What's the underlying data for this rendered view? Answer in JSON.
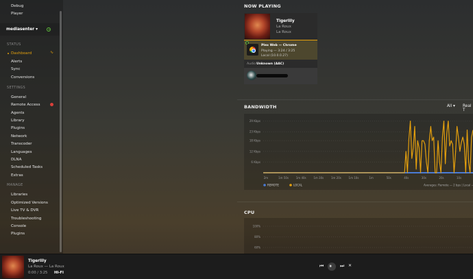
{
  "sidebar": {
    "top_items": [
      {
        "label": "Debug"
      },
      {
        "label": "Player"
      }
    ],
    "server": {
      "name": "mediasenter",
      "caret": "▾"
    },
    "status_heading": "STATUS",
    "status_items": [
      {
        "label": "Dashboard"
      },
      {
        "label": "Alerts"
      },
      {
        "label": "Sync"
      },
      {
        "label": "Conversions"
      }
    ],
    "settings_heading": "SETTINGS",
    "settings_items": [
      {
        "label": "General"
      },
      {
        "label": "Remote Access"
      },
      {
        "label": "Agents"
      },
      {
        "label": "Library"
      },
      {
        "label": "Plugins"
      },
      {
        "label": "Network"
      },
      {
        "label": "Transcoder"
      },
      {
        "label": "Languages"
      },
      {
        "label": "DLNA"
      },
      {
        "label": "Scheduled Tasks"
      },
      {
        "label": "Extras"
      }
    ],
    "manage_heading": "MANAGE",
    "manage_items": [
      {
        "label": "Libraries"
      },
      {
        "label": "Optimized Versions"
      },
      {
        "label": "Live TV & DVR"
      },
      {
        "label": "Troubleshooting"
      },
      {
        "label": "Console"
      },
      {
        "label": "Plugins"
      }
    ]
  },
  "now_playing": {
    "heading": "NOW PLAYING",
    "title": "Tigerlily",
    "artist": "La Roux",
    "album": "La Roux",
    "player_line1": "Plex Web  —  Chrome",
    "player_line2": "Playing — 3:24 / 3:25",
    "player_line3": "Local (10.0.0.27)",
    "audio_label": "Audio",
    "audio_value": "Unknown (AAC)"
  },
  "bandwidth": {
    "heading": "BANDWIDTH",
    "filter_all": "All ▾",
    "filter_real": "Real T"
  },
  "chart_data": {
    "type": "line",
    "title": "",
    "ylabel": "",
    "xlabel": "",
    "y_ticks": [
      "29 Kbps",
      "23 Kbps",
      "18 Kbps",
      "12 Kbps",
      "6 Kbps"
    ],
    "y_tick_values": [
      29,
      23,
      18,
      12,
      6
    ],
    "x_ticks": [
      "2m",
      "1m 50s",
      "1m 40s",
      "1m 30s",
      "1m 20s",
      "1m 10s",
      "1m",
      "50s",
      "40s",
      "30s",
      "20s",
      "10s"
    ],
    "ylim": [
      0,
      30
    ],
    "series": [
      {
        "name": "REMOTE",
        "color": "#4a7bd6",
        "values": [
          0,
          0,
          0,
          0,
          0,
          0,
          0,
          0,
          0,
          0,
          0,
          0,
          0,
          0,
          0,
          0,
          0,
          0,
          0,
          0,
          0,
          0,
          0,
          0,
          0,
          0,
          0,
          0,
          0,
          0,
          0,
          0,
          0,
          0,
          0,
          0,
          0,
          0,
          0,
          0,
          0,
          0,
          0,
          0,
          0,
          0,
          0,
          0,
          0,
          0,
          0,
          0,
          0,
          0,
          0,
          0,
          0,
          0,
          0,
          0,
          0,
          0,
          0,
          0,
          0,
          0,
          0,
          0,
          0,
          0,
          0,
          0,
          0,
          0,
          0,
          0,
          0,
          0,
          0,
          0,
          0,
          0,
          0,
          0,
          0,
          0,
          0,
          0,
          0,
          0,
          0,
          0,
          0,
          0,
          0,
          0,
          0,
          0,
          0,
          0,
          0,
          0,
          0,
          0,
          0,
          0,
          0,
          0,
          0,
          0,
          0,
          0,
          0,
          0,
          0,
          0,
          0,
          0,
          0,
          0
        ]
      },
      {
        "name": "LOCAL",
        "color": "#e5a00d",
        "values": [
          0,
          0,
          0,
          0,
          0,
          0,
          0,
          0,
          0,
          0,
          0,
          0,
          0,
          0,
          0,
          0,
          0,
          0,
          0,
          0,
          0,
          0,
          0,
          0,
          0,
          0,
          0,
          0,
          0,
          0,
          0,
          0,
          0,
          0,
          0,
          0,
          0,
          0,
          0,
          0,
          0,
          0,
          0,
          0,
          0,
          0,
          0,
          0,
          0,
          0,
          0,
          0,
          0,
          0,
          0,
          0,
          0,
          0,
          0,
          0,
          0,
          0,
          0,
          0,
          0,
          0,
          0,
          0,
          0,
          0,
          0,
          0,
          0,
          0,
          0,
          0,
          0,
          0,
          0,
          0,
          0,
          0,
          0,
          0,
          0,
          0,
          0,
          0,
          0,
          0,
          0,
          0,
          0,
          0,
          0,
          0,
          0,
          0,
          12,
          0,
          19,
          29,
          8,
          14,
          26,
          2,
          18,
          14,
          0,
          18,
          18,
          16,
          6,
          0,
          18,
          26,
          18,
          20,
          0,
          0,
          18,
          6,
          0,
          20,
          29,
          5,
          22,
          29,
          15,
          18,
          16,
          0,
          11,
          26,
          20,
          12,
          17,
          20,
          16,
          0,
          24,
          6,
          0,
          20,
          24
        ]
      }
    ],
    "legend": [
      "REMOTE",
      "LOCAL"
    ],
    "legend_placement": "bottom-left",
    "summary": "Averages: Remote — 2 bps  |  Local — 8"
  },
  "cpu": {
    "heading": "CPU",
    "y_ticks": [
      "100%",
      "80%",
      "60%"
    ]
  },
  "player_bar": {
    "title": "Tigerlily",
    "artist_album": "La Roux — La Roux",
    "time": "0:00 / 3:25",
    "quality": "HI-FI",
    "prev": "⏮",
    "play": "⏸",
    "next": "⏭",
    "stop": "✕"
  },
  "colors": {
    "accent": "#e5a00d",
    "remote": "#4a7bd6",
    "ok": "#5fbf3a",
    "warn": "#d9403a"
  }
}
